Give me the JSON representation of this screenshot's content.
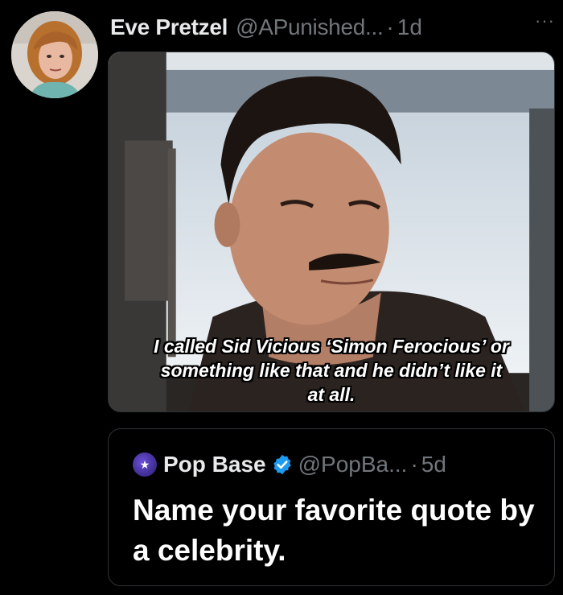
{
  "author": {
    "name": "Eve Pretzel",
    "handle": "@APunished...",
    "separator": "·",
    "time": "1d",
    "more_icon": "more-dots-icon"
  },
  "media": {
    "caption_lines": [
      "I called Sid Vicious ‘Simon Ferocious’ or",
      "something like that and he didn’t like it",
      "at all."
    ]
  },
  "quote": {
    "name": "Pop Base",
    "handle": "@PopBa...",
    "separator": "·",
    "time": "5d",
    "verified_icon": "verified-badge-icon",
    "text": "Name your favorite quote by a celebrity.",
    "verified_color": "#1d9bf0"
  },
  "colors": {
    "background": "#000000",
    "text_primary": "#e7e9ea",
    "text_secondary": "#71767b",
    "border": "#2f3336"
  }
}
